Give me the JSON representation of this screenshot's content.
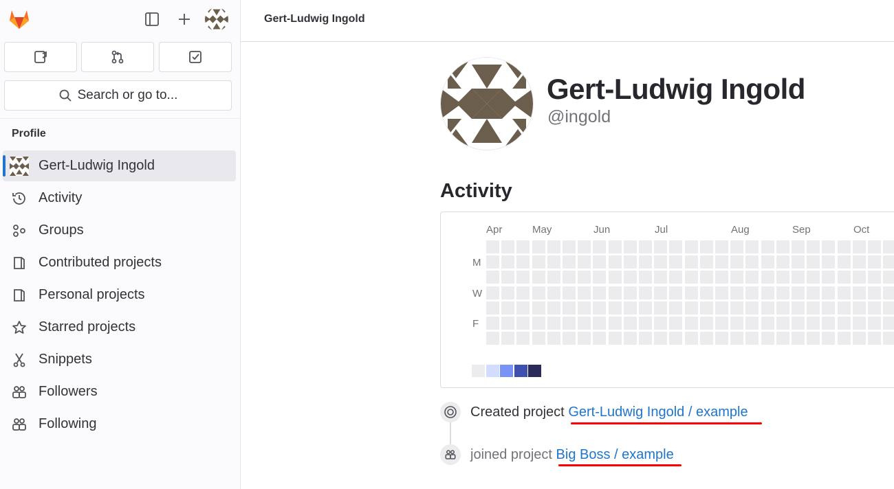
{
  "sidebar": {
    "search_label": "Search or go to...",
    "section_label": "Profile",
    "items": [
      {
        "label": "Gert-Ludwig Ingold",
        "icon": "user-avatar-icon",
        "active": true
      },
      {
        "label": "Activity",
        "icon": "history-icon"
      },
      {
        "label": "Groups",
        "icon": "groups-icon"
      },
      {
        "label": "Contributed projects",
        "icon": "project-icon"
      },
      {
        "label": "Personal projects",
        "icon": "project-icon"
      },
      {
        "label": "Starred projects",
        "icon": "star-icon"
      },
      {
        "label": "Snippets",
        "icon": "snippet-icon"
      },
      {
        "label": "Followers",
        "icon": "users-icon"
      },
      {
        "label": "Following",
        "icon": "users-icon"
      }
    ]
  },
  "header": {
    "breadcrumb": "Gert-Ludwig Ingold"
  },
  "profile": {
    "name": "Gert-Ludwig Ingold",
    "handle": "@ingold"
  },
  "activity": {
    "title": "Activity",
    "months": [
      "Apr",
      "May",
      "Jun",
      "Jul",
      "Aug",
      "Sep",
      "Oct"
    ],
    "day_labels": [
      "M",
      "W",
      "F"
    ],
    "legend_colors": [
      "#ececef",
      "#d2dcff",
      "#7992f5",
      "#3f51ae",
      "#2a2b59"
    ]
  },
  "feed": [
    {
      "verb": "Created project",
      "link": "Gert-Ludwig Ingold / example",
      "icon": "project-created-icon"
    },
    {
      "verb": "joined project",
      "link": "Big Boss / example",
      "icon": "users-icon"
    }
  ],
  "colors": {
    "accent": "#1f75cb",
    "annotation": "#ff0000",
    "avatar": "#6b5e4d"
  }
}
